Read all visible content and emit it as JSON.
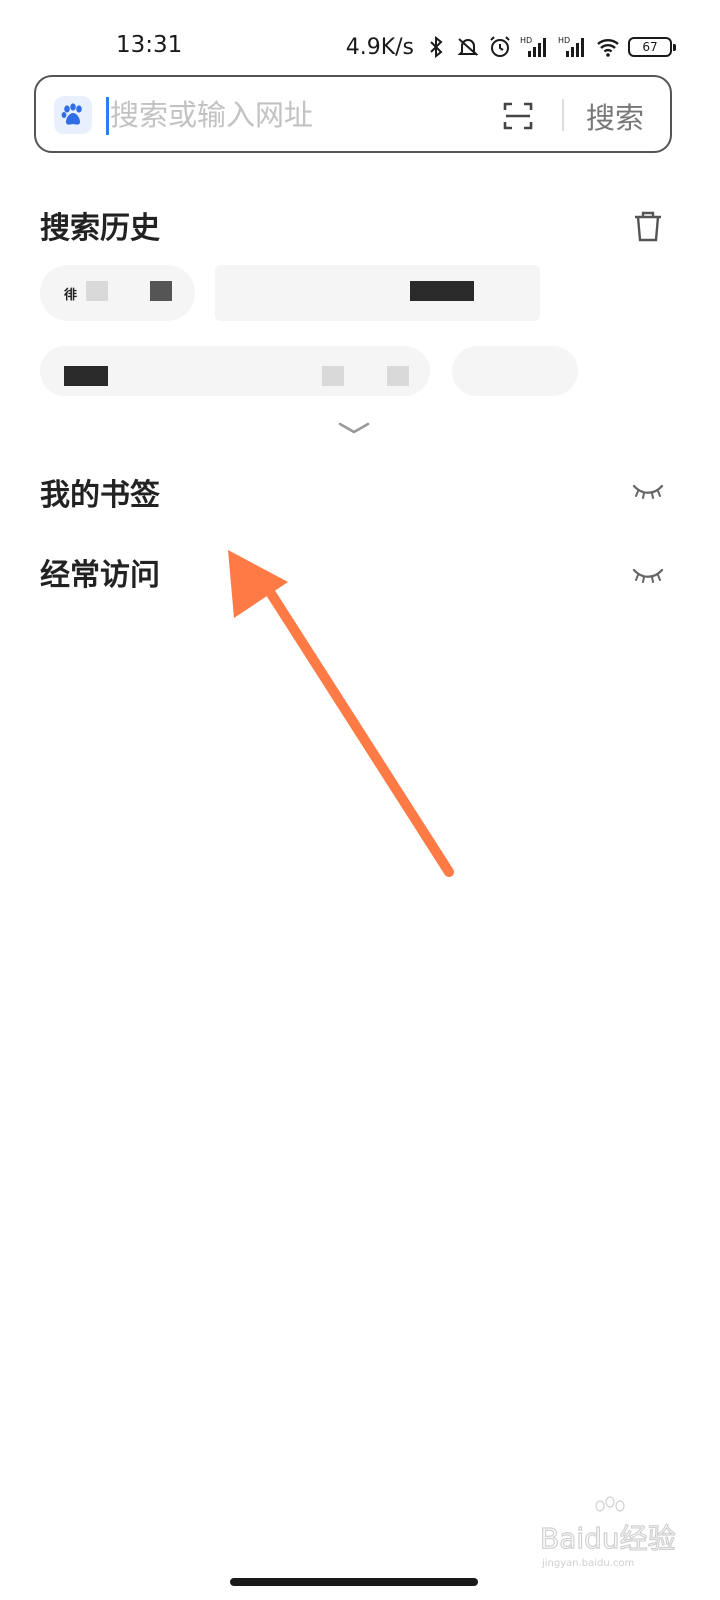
{
  "status_bar": {
    "time": "13:31",
    "net_speed": "4.9K/s",
    "battery": "67",
    "icons": [
      "bluetooth-icon",
      "mute-icon",
      "alarm-icon",
      "hd-signal-icon",
      "hd-signal-icon",
      "wifi-icon",
      "battery-icon"
    ]
  },
  "search": {
    "placeholder": "搜索或输入网址",
    "value": "",
    "button_label": "搜索",
    "logo": "baidu-paw-icon",
    "scan_icon": "scan-icon"
  },
  "history": {
    "title": "搜索历史",
    "clear_icon": "trash-icon",
    "chip_visible_text": "徘",
    "expand_icon": "chevron-down-icon"
  },
  "bookmarks": {
    "title": "我的书签",
    "toggle_icon": "eye-closed-icon"
  },
  "frequent": {
    "title": "经常访问",
    "toggle_icon": "eye-closed-icon"
  },
  "colors": {
    "accent": "#2b7cf6",
    "annotation_arrow": "#ff7a45",
    "logo_blue": "#2f6ee5"
  },
  "watermark_text": "Baidu经验 jingyan.baidu.com"
}
